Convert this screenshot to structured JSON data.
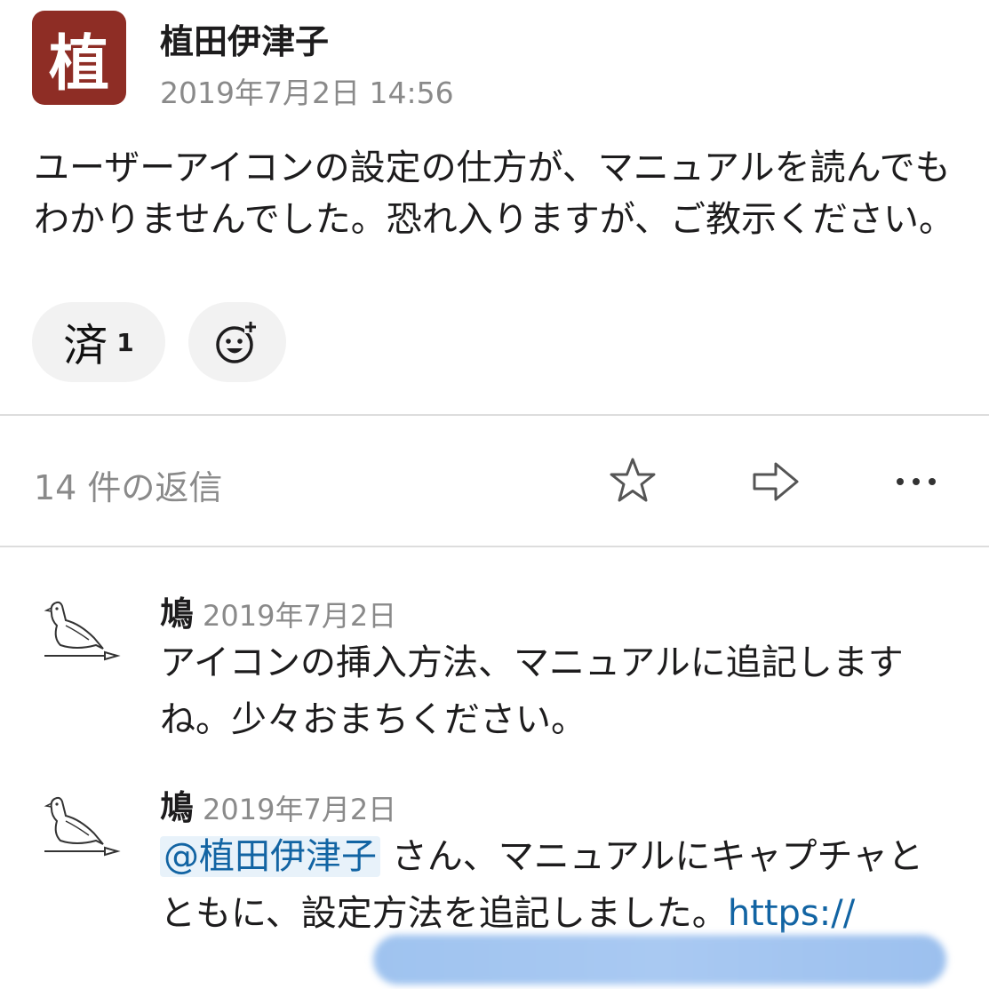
{
  "parent": {
    "avatar_char": "植",
    "author": "植田伊津子",
    "timestamp": "2019年7月2日 14:56",
    "text": "ユーザーアイコンの設定の仕方が、マニュアルを読んでもわかりませんでした。恐れ入りますが、ご教示ください。",
    "reaction": {
      "emoji": "済",
      "count": "1"
    },
    "add_reaction_icon": "add-emoji-icon"
  },
  "thread": {
    "reply_count_label": "14 件の返信",
    "actions": [
      "star-icon",
      "share-arrow-icon",
      "more-icon"
    ]
  },
  "replies": [
    {
      "author": "鳩",
      "date": "2019年7月2日",
      "text": "アイコンの挿入方法、マニュアルに追記しますね。少々おまちください。"
    },
    {
      "author": "鳩",
      "date": "2019年7月2日",
      "mention": "@植田伊津子",
      "text": " さん、マニュアルにキャプチャとともに、設定方法を追記しました。",
      "link": "https://"
    }
  ],
  "colors": {
    "avatar_bg": "#8e2d25",
    "link": "#1264a3",
    "mention_bg": "#e8f2fa",
    "muted": "#8a8a8a"
  }
}
